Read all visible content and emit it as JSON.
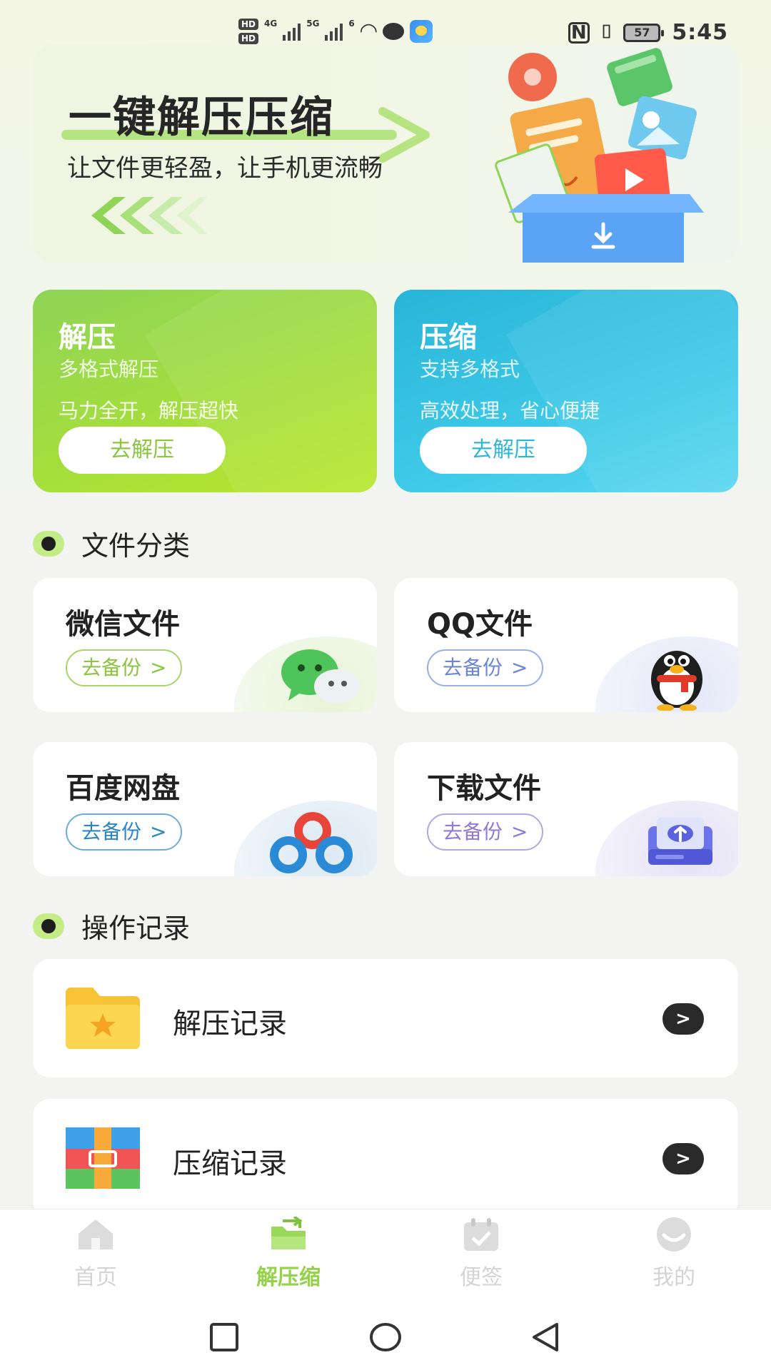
{
  "status_bar": {
    "hd1": "HD",
    "hd2": "HD",
    "net1": "4G",
    "net2": "5G",
    "wifi": "6",
    "battery": "57",
    "time": "5:45"
  },
  "banner": {
    "title": "一键解压压缩",
    "subtitle": "让文件更轻盈，让手机更流畅"
  },
  "actions": [
    {
      "title": "解压",
      "sub": "多格式解压",
      "desc": "马力全开，解压超快",
      "button": "去解压",
      "color": "#9ddb44"
    },
    {
      "title": "压缩",
      "sub": "支持多格式",
      "desc": "高效处理，省心便捷",
      "button": "去解压",
      "color": "#3ec9e8"
    }
  ],
  "section_files": "文件分类",
  "categories": [
    {
      "title": "微信文件",
      "button": "去备份",
      "arrow": ">",
      "icon": "wechat-icon",
      "color": "#8cc540"
    },
    {
      "title": "QQ文件",
      "button": "去备份",
      "arrow": ">",
      "icon": "qq-penguin-icon",
      "color": "#6b86d6"
    },
    {
      "title": "百度网盘",
      "button": "去备份",
      "arrow": ">",
      "icon": "baidu-netdisk-icon",
      "color": "#2a86c8"
    },
    {
      "title": "下载文件",
      "button": "去备份",
      "arrow": ">",
      "icon": "cloud-download-icon",
      "color": "#8f7ad8"
    }
  ],
  "section_records": "操作记录",
  "records": [
    {
      "label": "解压记录",
      "icon": "star-folder-icon",
      "go": ">"
    },
    {
      "label": "压缩记录",
      "icon": "archive-box-icon",
      "go": ">"
    }
  ],
  "nav": {
    "home": "首页",
    "compress": "解压缩",
    "notes": "便签",
    "mine": "我的",
    "active_color": "#94d24a"
  }
}
